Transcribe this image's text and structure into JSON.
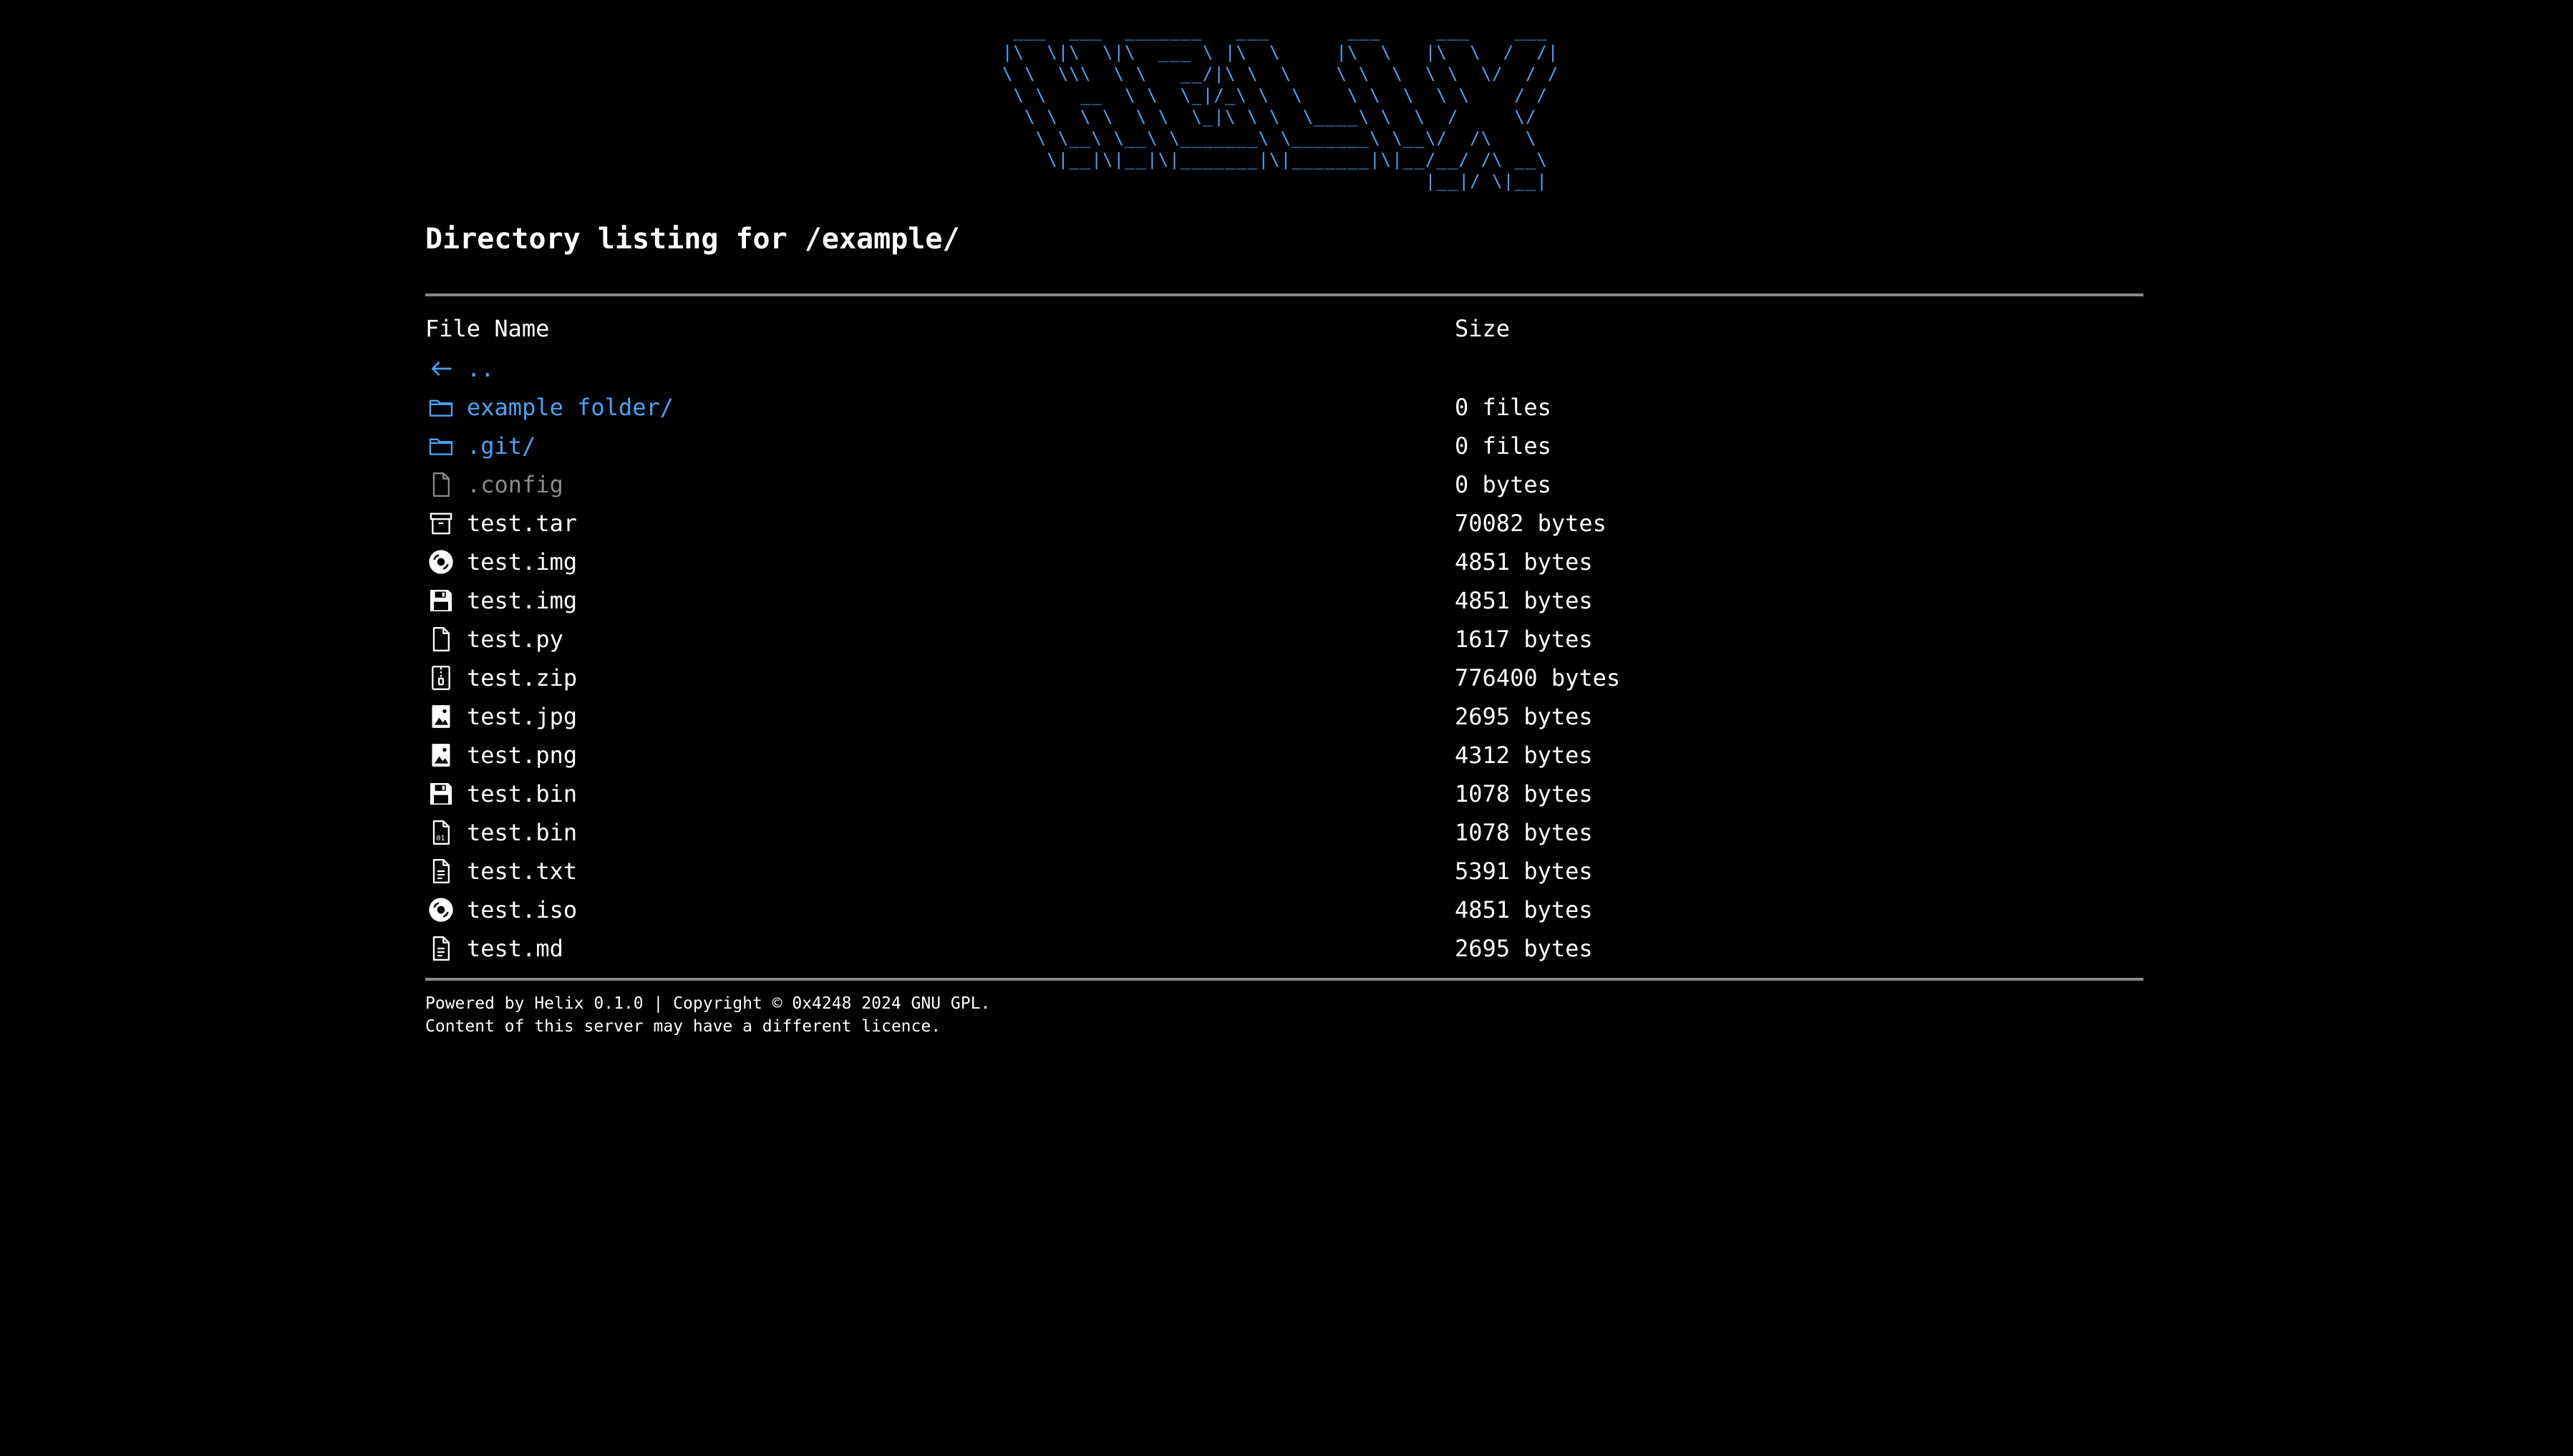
{
  "logo_ascii": " ___  ___  _______   ___       ___     ___    ___ \n|\\  \\|\\  \\|\\  ___ \\ |\\  \\     |\\  \\   |\\  \\  /  /|\n\\ \\  \\\\\\  \\ \\   __/|\\ \\  \\    \\ \\  \\  \\ \\  \\/  / /\n \\ \\   __  \\ \\  \\_|/_\\ \\  \\    \\ \\  \\  \\ \\    / / \n  \\ \\  \\ \\  \\ \\  \\_|\\ \\ \\  \\____\\ \\  \\  /     \\/  \n   \\ \\__\\ \\__\\ \\_______\\ \\_______\\ \\__\\/  /\\   \\  \n    \\|__|\\|__|\\|_______|\\|_______|\\|__/__/ /\\ __\\ \n                                      |__|/ \\|__| ",
  "title": "Directory listing for /example/",
  "table": {
    "headers": {
      "name": "File Name",
      "size": "Size"
    },
    "rows": [
      {
        "icon": "back-arrow-icon",
        "name": "..",
        "size": "",
        "kind": "dir"
      },
      {
        "icon": "folder-icon",
        "name": "example folder/",
        "size": "0 files",
        "kind": "dir"
      },
      {
        "icon": "folder-icon",
        "name": ".git/",
        "size": "0 files",
        "kind": "hidden-dir"
      },
      {
        "icon": "file-icon",
        "name": ".config",
        "size": "0 bytes",
        "kind": "hidden"
      },
      {
        "icon": "archive-icon",
        "name": "test.tar",
        "size": "70082 bytes",
        "kind": "file"
      },
      {
        "icon": "disc-icon",
        "name": "test.img",
        "size": "4851 bytes",
        "kind": "file"
      },
      {
        "icon": "floppy-disk-icon",
        "name": "test.img",
        "size": "4851 bytes",
        "kind": "file"
      },
      {
        "icon": "file-icon",
        "name": "test.py",
        "size": "1617 bytes",
        "kind": "file"
      },
      {
        "icon": "zip-file-icon",
        "name": "test.zip",
        "size": "776400 bytes",
        "kind": "file"
      },
      {
        "icon": "image-file-icon",
        "name": "test.jpg",
        "size": "2695 bytes",
        "kind": "file"
      },
      {
        "icon": "image-file-icon",
        "name": "test.png",
        "size": "4312 bytes",
        "kind": "file"
      },
      {
        "icon": "floppy-disk-icon",
        "name": "test.bin",
        "size": "1078 bytes",
        "kind": "file"
      },
      {
        "icon": "binary-file-icon",
        "name": "test.bin",
        "size": "1078 bytes",
        "kind": "file"
      },
      {
        "icon": "text-file-icon",
        "name": "test.txt",
        "size": "5391 bytes",
        "kind": "file"
      },
      {
        "icon": "disc-icon",
        "name": "test.iso",
        "size": "4851 bytes",
        "kind": "file"
      },
      {
        "icon": "text-file-icon",
        "name": "test.md",
        "size": "2695 bytes",
        "kind": "file"
      }
    ]
  },
  "footer": {
    "line1": "Powered by Helix 0.1.0 | Copyright © 0x4248 2024 GNU GPL.",
    "line2": "Content of this server may have a different licence."
  },
  "colors": {
    "background": "#000000",
    "link_dir": "#4aa3f5",
    "hidden": "#8a8a8a",
    "rule": "#8a8a8a"
  }
}
